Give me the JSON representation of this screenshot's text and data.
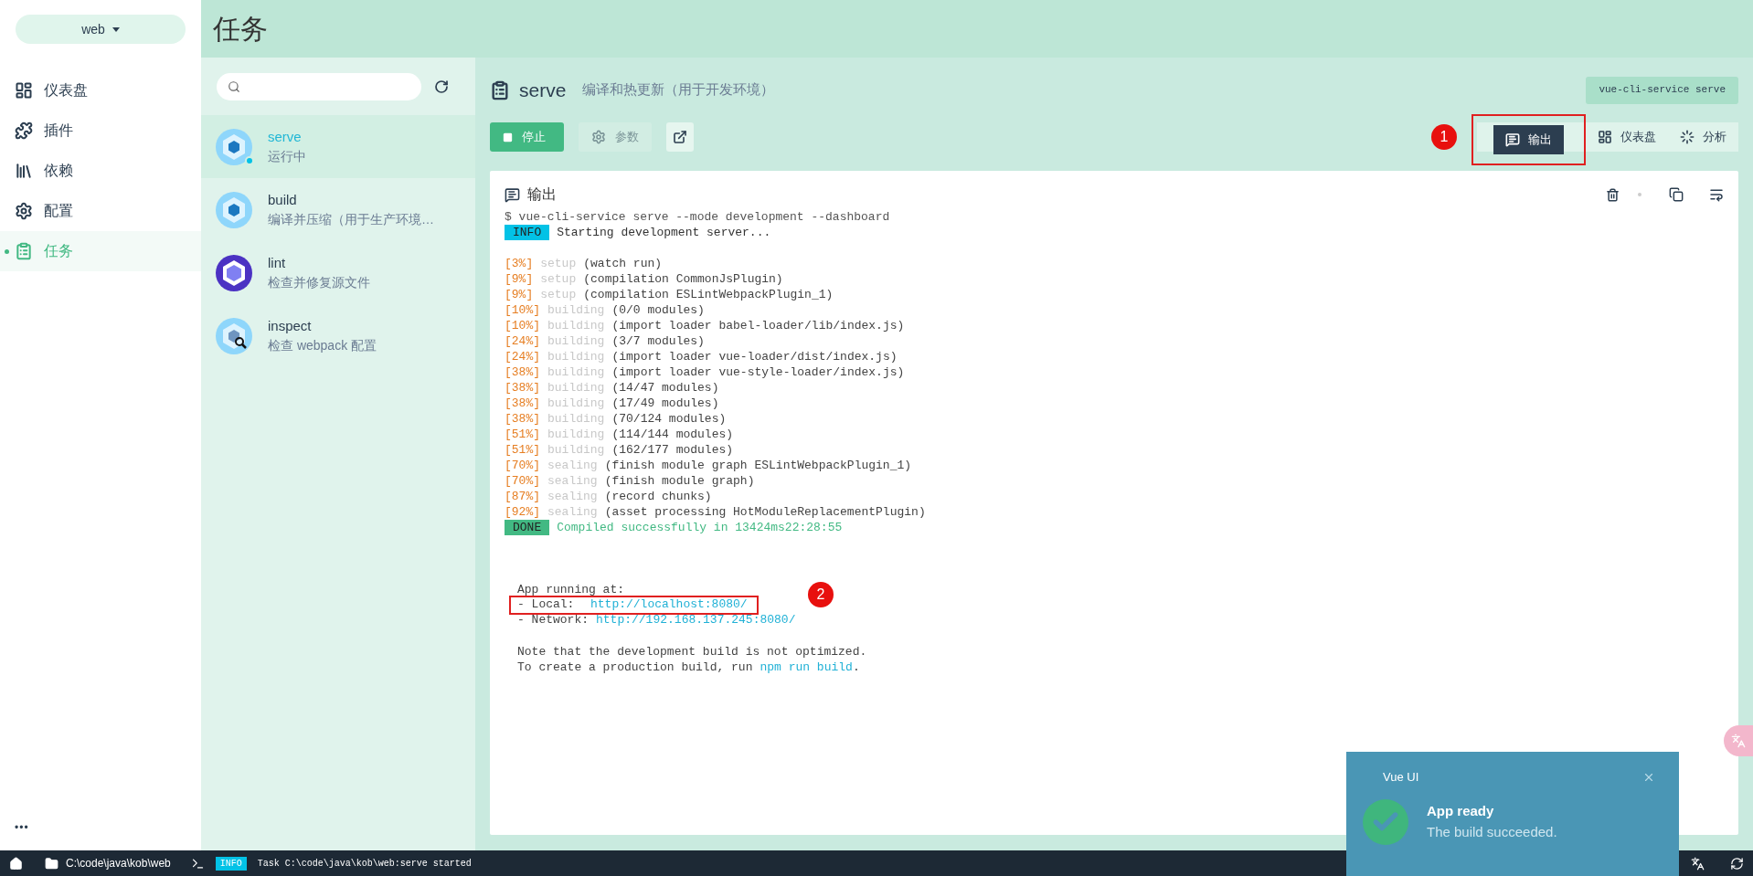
{
  "project_selector": {
    "label": "web"
  },
  "nav": [
    {
      "label": "仪表盘",
      "selected": false
    },
    {
      "label": "插件",
      "selected": false
    },
    {
      "label": "依赖",
      "selected": false
    },
    {
      "label": "配置",
      "selected": false
    },
    {
      "label": "任务",
      "selected": true
    }
  ],
  "more_label": "•••",
  "page_title": "任务",
  "tasks": [
    {
      "name": "serve",
      "description": "运行中",
      "kind": "webpack",
      "running": true,
      "selected": true
    },
    {
      "name": "build",
      "description": "编译并压缩（用于生产环境…",
      "kind": "webpack",
      "running": false,
      "selected": false
    },
    {
      "name": "lint",
      "description": "检查并修复源文件",
      "kind": "eslint",
      "running": false,
      "selected": false
    },
    {
      "name": "inspect",
      "description": "检查 webpack 配置",
      "kind": "inspect",
      "running": false,
      "selected": false
    }
  ],
  "task_header": {
    "name": "serve",
    "description": "编译和热更新（用于开发环境）",
    "command": "vue-cli-service serve"
  },
  "actions": [
    {
      "label": "停止",
      "kind": "stop",
      "disabled": false
    },
    {
      "label": "参数",
      "kind": "params",
      "disabled": true
    },
    {
      "kind": "open",
      "disabled": false
    }
  ],
  "views": [
    {
      "label": "输出",
      "selected": true
    },
    {
      "label": "仪表盘",
      "selected": false
    },
    {
      "label": "分析",
      "selected": false
    }
  ],
  "annotations": [
    {
      "number": "1"
    },
    {
      "number": "2"
    }
  ],
  "output": {
    "title": "输出",
    "lines": [
      {
        "kind": "command",
        "text": "$ vue-cli-service serve --mode development --dashboard"
      },
      {
        "kind": "info",
        "badge": "INFO",
        "text": "Starting development server..."
      },
      {
        "kind": "blank"
      },
      {
        "kind": "progress",
        "percent": "[3%]",
        "phase": "setup",
        "detail": "(watch run)"
      },
      {
        "kind": "progress",
        "percent": "[9%]",
        "phase": "setup",
        "detail": "(compilation CommonJsPlugin)"
      },
      {
        "kind": "progress",
        "percent": "[9%]",
        "phase": "setup",
        "detail": "(compilation ESLintWebpackPlugin_1)"
      },
      {
        "kind": "progress",
        "percent": "[10%]",
        "phase": "building",
        "detail": "(0/0 modules)"
      },
      {
        "kind": "progress",
        "percent": "[10%]",
        "phase": "building",
        "detail": "(import loader babel-loader/lib/index.js)"
      },
      {
        "kind": "progress",
        "percent": "[24%]",
        "phase": "building",
        "detail": "(3/7 modules)"
      },
      {
        "kind": "progress",
        "percent": "[24%]",
        "phase": "building",
        "detail": "(import loader vue-loader/dist/index.js)"
      },
      {
        "kind": "progress",
        "percent": "[38%]",
        "phase": "building",
        "detail": "(import loader vue-style-loader/index.js)"
      },
      {
        "kind": "progress",
        "percent": "[38%]",
        "phase": "building",
        "detail": "(14/47 modules)"
      },
      {
        "kind": "progress",
        "percent": "[38%]",
        "phase": "building",
        "detail": "(17/49 modules)"
      },
      {
        "kind": "progress",
        "percent": "[38%]",
        "phase": "building",
        "detail": "(70/124 modules)"
      },
      {
        "kind": "progress",
        "percent": "[51%]",
        "phase": "building",
        "detail": "(114/144 modules)"
      },
      {
        "kind": "progress",
        "percent": "[51%]",
        "phase": "building",
        "detail": "(162/177 modules)"
      },
      {
        "kind": "progress",
        "percent": "[70%]",
        "phase": "sealing",
        "detail": "(finish module graph ESLintWebpackPlugin_1)"
      },
      {
        "kind": "progress",
        "percent": "[70%]",
        "phase": "sealing",
        "detail": "(finish module graph)"
      },
      {
        "kind": "progress",
        "percent": "[87%]",
        "phase": "sealing",
        "detail": "(record chunks)"
      },
      {
        "kind": "progress",
        "percent": "[92%]",
        "phase": "sealing",
        "detail": "(asset processing HotModuleReplacementPlugin)"
      },
      {
        "kind": "done",
        "badge": "DONE",
        "text": "Compiled successfully in 13424ms22:28:55"
      },
      {
        "kind": "blank"
      },
      {
        "kind": "blank"
      },
      {
        "kind": "blank"
      },
      {
        "kind": "text",
        "text": "App running at:"
      },
      {
        "kind": "link",
        "label": "- Local:",
        "url": "http://localhost:8080/",
        "highlighted": true
      },
      {
        "kind": "link",
        "label": "- Network:",
        "url": "http://192.168.137.245:8080/",
        "highlighted": false
      },
      {
        "kind": "blank"
      },
      {
        "kind": "text",
        "text": "Note that the development build is not optimized."
      },
      {
        "kind": "text_link",
        "text": "To create a production build, run",
        "url": "npm run build",
        "after": "."
      }
    ]
  },
  "status_bar": {
    "folder": "C:\\code\\java\\kob\\web",
    "badge": "INFO",
    "message": "Task C:\\code\\java\\kob\\web:serve started"
  },
  "notification": {
    "app": "Vue UI",
    "title": "App ready",
    "message": "The build succeeded."
  }
}
